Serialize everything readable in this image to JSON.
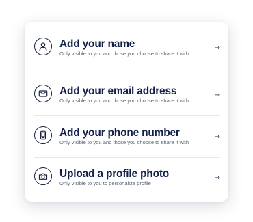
{
  "items": [
    {
      "title": "Add your name",
      "description": "Only visible to you and those you choose to share it with",
      "icon": "person-icon"
    },
    {
      "title": "Add your email address",
      "description": "Only visible to you and those you choose to share it with",
      "icon": "mail-icon"
    },
    {
      "title": "Add your phone number",
      "description": "Only visible to you and those you choose to share it with",
      "icon": "phone-icon"
    },
    {
      "title": "Upload a profile photo",
      "description": "Only visible to you to personalize profile",
      "icon": "camera-icon"
    }
  ],
  "arrow_glyph": "→",
  "colors": {
    "title": "#13204a",
    "description": "#5c6270",
    "divider": "#e6e8ee",
    "card_background": "#ffffff"
  }
}
